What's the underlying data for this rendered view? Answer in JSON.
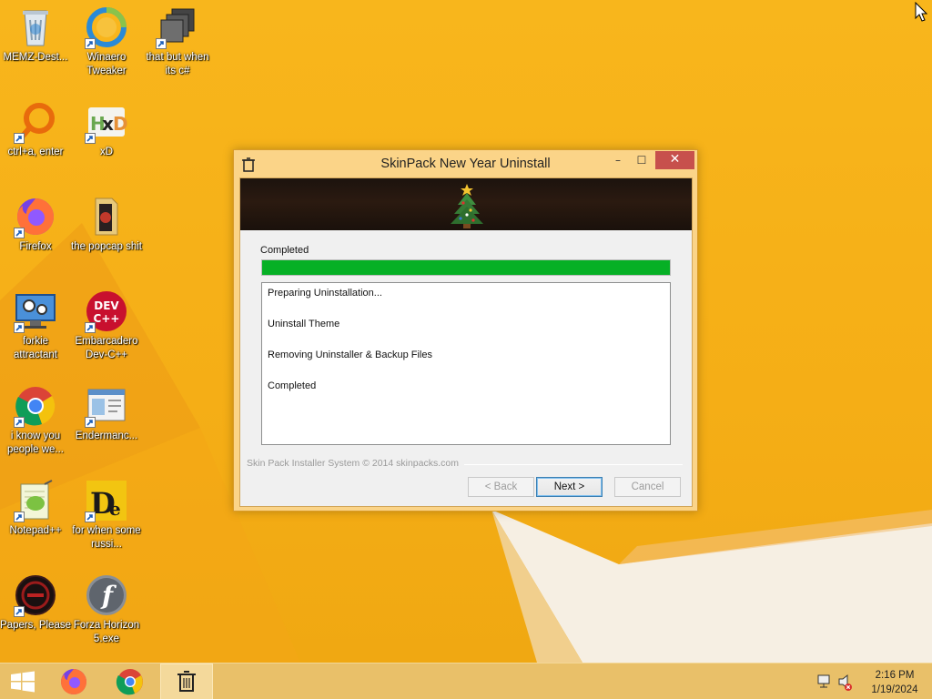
{
  "desktop": {
    "icons": [
      {
        "label": "MEMZ-Dest...",
        "icon": "recycle-bin-icon"
      },
      {
        "label": "Winaero Tweaker",
        "icon": "winaero-icon"
      },
      {
        "label": "that but when its c#",
        "icon": "stacked-windows-icon"
      },
      {
        "label": "ctrl+a, enter",
        "icon": "magnifier-ring-icon"
      },
      {
        "label": "xD",
        "icon": "hxd-icon"
      },
      {
        "label": "Firefox",
        "icon": "firefox-icon"
      },
      {
        "label": "the popcap shit",
        "icon": "folder-icon"
      },
      {
        "label": "forkie attractant",
        "icon": "monitor-gear-icon"
      },
      {
        "label": "Embarcadero Dev-C++",
        "icon": "devcpp-icon"
      },
      {
        "label": "i know you people we...",
        "icon": "chrome-icon"
      },
      {
        "label": "Endermanc...",
        "icon": "app-window-icon"
      },
      {
        "label": "Notepad++",
        "icon": "notepadpp-icon"
      },
      {
        "label": "for when some russi...",
        "icon": "de-icon"
      },
      {
        "label": "Papers, Please",
        "icon": "papers-please-icon"
      },
      {
        "label": "Forza Horizon 5.exe",
        "icon": "flash-icon"
      }
    ]
  },
  "dialog": {
    "title": "SkinPack New Year Uninstall",
    "status_label": "Completed",
    "progress_percent": 100,
    "progress_color": "#06b025",
    "log": [
      "Preparing Uninstallation...",
      "Uninstall Theme",
      "Removing Uninstaller & Backup Files",
      "Completed"
    ],
    "footer": "Skin Pack Installer System © 2014 skinpacks.com",
    "buttons": {
      "back": "< Back",
      "next": "Next >",
      "cancel": "Cancel"
    },
    "title_buttons": {
      "minimize": "–",
      "maximize": "☐",
      "close": "✕"
    }
  },
  "taskbar": {
    "items": [
      "start-button",
      "firefox",
      "chrome",
      "skinpack-uninstaller"
    ],
    "clock_time": "2:16 PM",
    "clock_date": "1/19/2024"
  },
  "colors": {
    "wallpaper": "#f6b21a",
    "taskbar": "#e9c069",
    "dialog_frame": "#fbd488",
    "close_button": "#c7504c"
  }
}
